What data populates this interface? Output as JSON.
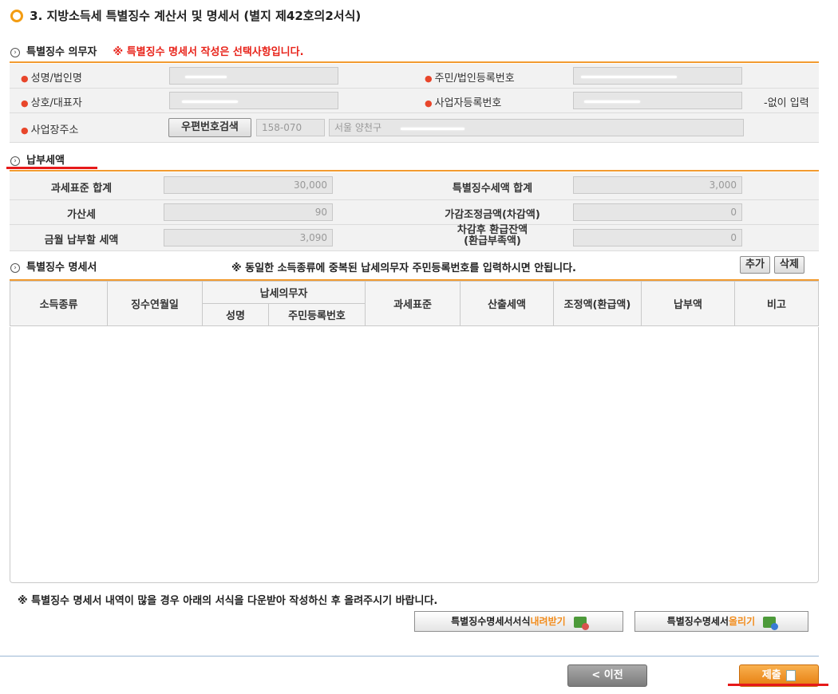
{
  "page": {
    "title": "3. 지방소득세 특별징수 계산서 및 명세서 (별지 제42호의2서식)"
  },
  "obligor": {
    "section_title": "특별징수 의무자",
    "notice": "※ 특별징수 명세서 작성은 선택사항입니다.",
    "name_label": "성명/법인명",
    "rrn_label": "주민/법인등록번호",
    "company_label": "상호/대표자",
    "bizno_label": "사업자등록번호",
    "bizno_hint": "-없이 입력",
    "address_label": "사업장주소",
    "zip_search_button": "우편번호검색",
    "zip_value": "158-070",
    "address_value": "서울 양천구"
  },
  "tax": {
    "section_title": "납부세액",
    "base_total_label": "과세표준 합계",
    "base_total_value": "30,000",
    "withheld_total_label": "특별징수세액 합계",
    "withheld_total_value": "3,000",
    "penalty_label": "가산세",
    "penalty_value": "90",
    "adjust_label": "가감조정금액(차감액)",
    "adjust_value": "0",
    "payable_label": "금월 납부할 세액",
    "payable_value": "3,090",
    "refund_label_1": "차감후 환급잔액",
    "refund_label_2": "(환급부족액)",
    "refund_value": "0"
  },
  "details": {
    "section_title": "특별징수 명세서",
    "notice": "※ 동일한 소득종류에 중복된 납세의무자 주민등록번호를 입력하시면 안됩니다.",
    "add_button": "추가",
    "delete_button": "삭제",
    "columns": {
      "income_type": "소득종류",
      "collect_month": "징수연월일",
      "taxpayer": "납세의무자",
      "taxpayer_name": "성명",
      "taxpayer_rrn": "주민등록번호",
      "tax_base": "과세표준",
      "calc_tax": "산출세액",
      "adjust": "조정액(환급액)",
      "paid": "납부액",
      "remark": "비고"
    }
  },
  "footer": {
    "notice": "※ 특별징수 명세서 내역이 많을 경우 아래의 서식을 다운받아 작성하신 후 올려주시기 바랍니다.",
    "download_prefix": "특별징수명세서서식",
    "download_action": "내려받기",
    "upload_prefix": "특별징수명세서",
    "upload_action": "올리기",
    "prev_button": "< 이전",
    "submit_button": "제출"
  },
  "colors": {
    "accent_orange": "#f29b30",
    "notice_red": "#e8231a",
    "submit_bg": "#f28c1c"
  }
}
